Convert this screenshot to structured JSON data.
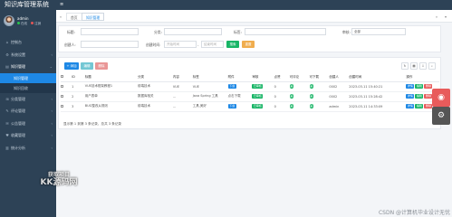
{
  "app": {
    "title": "知识库管理系统"
  },
  "user": {
    "name": "admin",
    "status_online": "在线",
    "status_logout": "注销"
  },
  "sidebar": {
    "items": [
      {
        "icon": "dashboard-icon",
        "glyph": "⌂",
        "label": "控制台"
      },
      {
        "icon": "settings-icon",
        "glyph": "⚙",
        "label": "系统设置"
      },
      {
        "icon": "knowledge-icon",
        "glyph": "▤",
        "label": "知识管理"
      },
      {
        "icon": "classify-icon",
        "glyph": "⊞",
        "label": "分类管理"
      },
      {
        "icon": "comment-icon",
        "glyph": "✎",
        "label": "评论管理"
      },
      {
        "icon": "notice-icon",
        "glyph": "✉",
        "label": "公告管理"
      },
      {
        "icon": "favorite-icon",
        "glyph": "♥",
        "label": "收藏管理"
      },
      {
        "icon": "stats-icon",
        "glyph": "▥",
        "label": "统计分析"
      }
    ],
    "sub_items": [
      {
        "label": "知识管理"
      },
      {
        "label": "知识回收"
      }
    ]
  },
  "watermark_sidebar": {
    "line1": "获取项目",
    "line2": "KK源码网"
  },
  "tabs": [
    {
      "label": "首页"
    },
    {
      "label": "知识管理"
    }
  ],
  "search": {
    "fields": [
      {
        "label": "标题:",
        "placeholder": ""
      },
      {
        "label": "分类:",
        "value": ""
      },
      {
        "label": "标签:",
        "placeholder": ""
      },
      {
        "label": "审核:",
        "value": "全部"
      },
      {
        "label": "创建人:",
        "placeholder": ""
      },
      {
        "label": "创建时间:",
        "start_placeholder": "开始时间",
        "end_placeholder": "结束时间"
      }
    ],
    "search_button": "搜索",
    "reset_button": "重置"
  },
  "toolbar": {
    "add": "+ 添加",
    "edit": "编辑",
    "delete": "删除"
  },
  "table": {
    "columns": [
      "",
      "ID",
      "标题",
      "分类",
      "内容",
      "标签",
      "附件",
      "审核",
      "点赞",
      "可评论",
      "可下载",
      "创建人",
      "创建时间",
      "操作"
    ],
    "rows": [
      {
        "id": "1",
        "title": "VUE技术框架教程1",
        "category": "前端技术",
        "content": "VUE",
        "tag": "VUE",
        "attachment": "下载",
        "audit": "已审核",
        "likes": "0",
        "comment": "是",
        "download": "是",
        "creator": "0002",
        "created": "2023-03-11 15:40:21"
      },
      {
        "id": "2",
        "title": "用户表单",
        "category": "数据库相关",
        "content": "...",
        "tag": "Java Spring 工具",
        "attachment": "点击下载",
        "audit": "已审核",
        "likes": "0",
        "comment": "是",
        "download": "是",
        "creator": "0002",
        "created": "2023-03-11 15:28:42"
      },
      {
        "id": "3",
        "title": "BUG整改从规则",
        "category": "前端技术",
        "content": "...",
        "tag": "工具,美好",
        "attachment": "下载",
        "audit": "已审核",
        "likes": "0",
        "comment": "是",
        "download": "是",
        "creator": "admin",
        "created": "2023-03-11 14:33:09"
      }
    ],
    "row_actions": {
      "detail": "详情",
      "edit": "编辑",
      "delete": "删除"
    },
    "summary": "显示第 1 到第 3 条记录，总共 3 条记录"
  },
  "footer_watermark": "CSDN @计算机毕业设计无忧",
  "colors": {
    "sidebar": "#2d4256",
    "primary": "#1e88e5",
    "success": "#18b566",
    "warning": "#f0ad4e",
    "danger": "#e85b5b"
  }
}
